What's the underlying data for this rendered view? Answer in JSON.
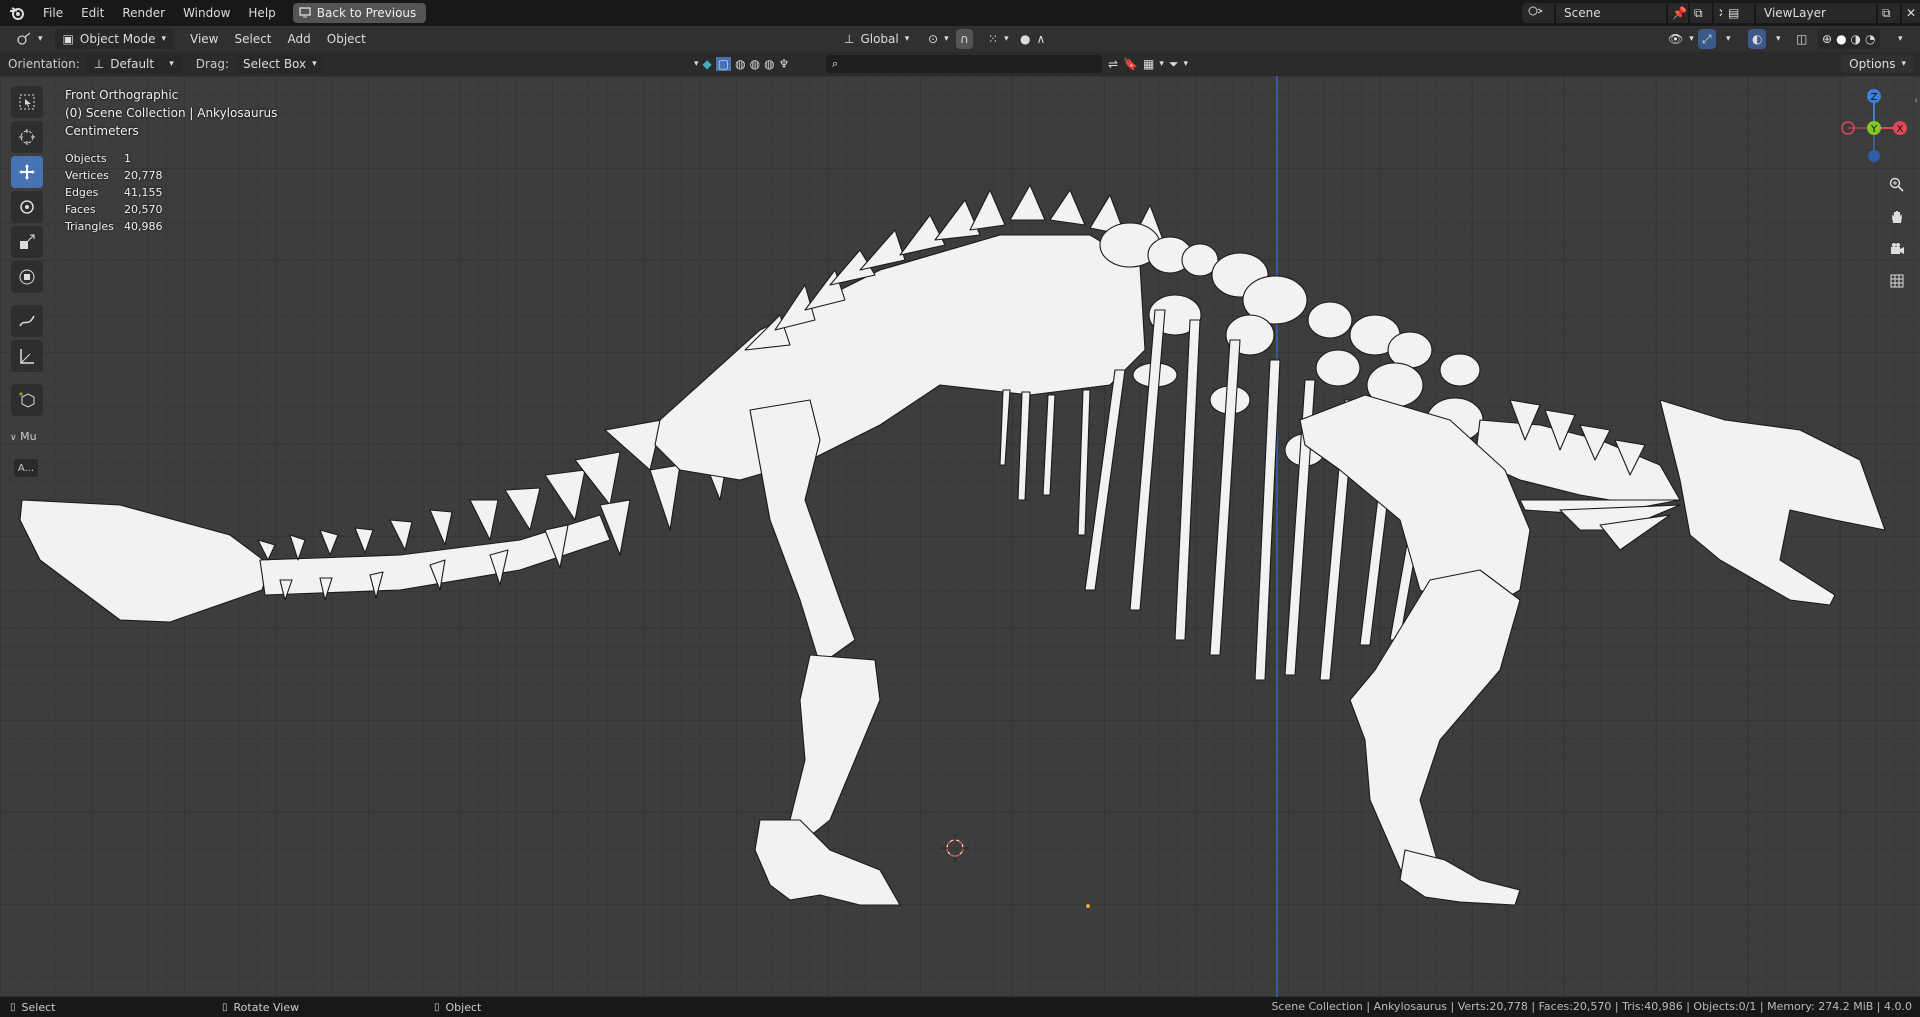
{
  "topbar": {
    "menus": [
      "File",
      "Edit",
      "Render",
      "Window",
      "Help"
    ],
    "back_button": "Back to Previous",
    "scene": "Scene",
    "view_layer": "ViewLayer"
  },
  "header": {
    "mode": "Object Mode",
    "menus": [
      "View",
      "Select",
      "Add",
      "Object"
    ],
    "transform_orientation": "Global"
  },
  "tool_header": {
    "orientation_label": "Orientation:",
    "orientation_value": "Default",
    "drag_label": "Drag:",
    "drag_value": "Select Box",
    "options": "Options"
  },
  "viewport": {
    "view_name": "Front Orthographic",
    "collection": "(0) Scene Collection | Ankylosaurus",
    "units": "Centimeters",
    "stats": [
      {
        "label": "Objects",
        "value": "1"
      },
      {
        "label": "Vertices",
        "value": "20,778"
      },
      {
        "label": "Edges",
        "value": "41,155"
      },
      {
        "label": "Faces",
        "value": "20,570"
      },
      {
        "label": "Triangles",
        "value": "40,986"
      }
    ],
    "gizmo_axes": [
      "Z",
      "Y",
      "X"
    ],
    "side_panel_label": "Mu",
    "side_tab_label": "A..."
  },
  "statusbar": {
    "select": "Select",
    "rotate": "Rotate View",
    "object": "Object",
    "info": "Scene Collection | Ankylosaurus | Verts:20,778 | Faces:20,570 | Tris:40,986 | Objects:0/1 | Memory: 274.2 MiB | 4.0.0"
  },
  "colors": {
    "accent": "#4772b3",
    "axis_x": "#e0485a",
    "axis_y": "#7ec82a",
    "axis_z": "#3c7fe0"
  }
}
